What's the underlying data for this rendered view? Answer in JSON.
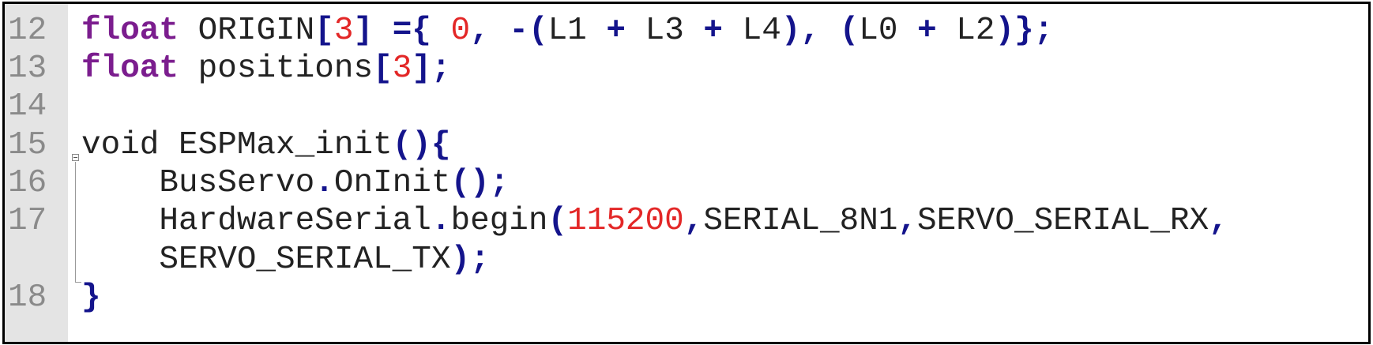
{
  "editor": {
    "lines": [
      {
        "number": "12",
        "tokens": [
          {
            "type": "kw",
            "text": "float"
          },
          {
            "type": "txt",
            "text": " ORIGIN"
          },
          {
            "type": "op",
            "text": "["
          },
          {
            "type": "nm",
            "text": "3"
          },
          {
            "type": "op",
            "text": "]"
          },
          {
            "type": "txt",
            "text": " "
          },
          {
            "type": "op",
            "text": "={"
          },
          {
            "type": "txt",
            "text": " "
          },
          {
            "type": "nm",
            "text": "0"
          },
          {
            "type": "op",
            "text": ","
          },
          {
            "type": "txt",
            "text": " "
          },
          {
            "type": "op",
            "text": "-("
          },
          {
            "type": "txt",
            "text": "L1 "
          },
          {
            "type": "op",
            "text": "+"
          },
          {
            "type": "txt",
            "text": " L3 "
          },
          {
            "type": "op",
            "text": "+"
          },
          {
            "type": "txt",
            "text": " L4"
          },
          {
            "type": "op",
            "text": "),"
          },
          {
            "type": "txt",
            "text": " "
          },
          {
            "type": "op",
            "text": "("
          },
          {
            "type": "txt",
            "text": "L0 "
          },
          {
            "type": "op",
            "text": "+"
          },
          {
            "type": "txt",
            "text": " L2"
          },
          {
            "type": "op",
            "text": ")};"
          }
        ]
      },
      {
        "number": "13",
        "tokens": [
          {
            "type": "kw",
            "text": "float"
          },
          {
            "type": "txt",
            "text": " positions"
          },
          {
            "type": "op",
            "text": "["
          },
          {
            "type": "nm",
            "text": "3"
          },
          {
            "type": "op",
            "text": "];"
          }
        ]
      },
      {
        "number": "14",
        "tokens": []
      },
      {
        "number": "15",
        "tokens": [
          {
            "type": "txt",
            "text": "void ESPMax_init"
          },
          {
            "type": "op",
            "text": "(){"
          }
        ]
      },
      {
        "number": "16",
        "tokens": [
          {
            "type": "txt",
            "text": "    BusServo"
          },
          {
            "type": "op",
            "text": "."
          },
          {
            "type": "txt",
            "text": "OnInit"
          },
          {
            "type": "op",
            "text": "();"
          }
        ]
      },
      {
        "number": "17",
        "tokens": [
          {
            "type": "txt",
            "text": "    HardwareSerial"
          },
          {
            "type": "op",
            "text": "."
          },
          {
            "type": "txt",
            "text": "begin"
          },
          {
            "type": "op",
            "text": "("
          },
          {
            "type": "nm",
            "text": "115200"
          },
          {
            "type": "op",
            "text": ","
          },
          {
            "type": "txt",
            "text": "SERIAL_8N1"
          },
          {
            "type": "op",
            "text": ","
          },
          {
            "type": "txt",
            "text": "SERVO_SERIAL_RX"
          },
          {
            "type": "op",
            "text": ","
          }
        ]
      },
      {
        "number": "",
        "tokens": [
          {
            "type": "txt",
            "text": "    SERVO_SERIAL_TX"
          },
          {
            "type": "op",
            "text": ");"
          }
        ]
      },
      {
        "number": "18",
        "tokens": [
          {
            "type": "op",
            "text": "}"
          }
        ]
      }
    ],
    "colors": {
      "keyword": "#7b1d8e",
      "operator": "#14148c",
      "number": "#e32727",
      "text": "#222222",
      "gutter_text": "#8a8a8a",
      "gutter_background": "#e4e4e4"
    },
    "icons": [
      "fold-collapse-icon"
    ]
  }
}
